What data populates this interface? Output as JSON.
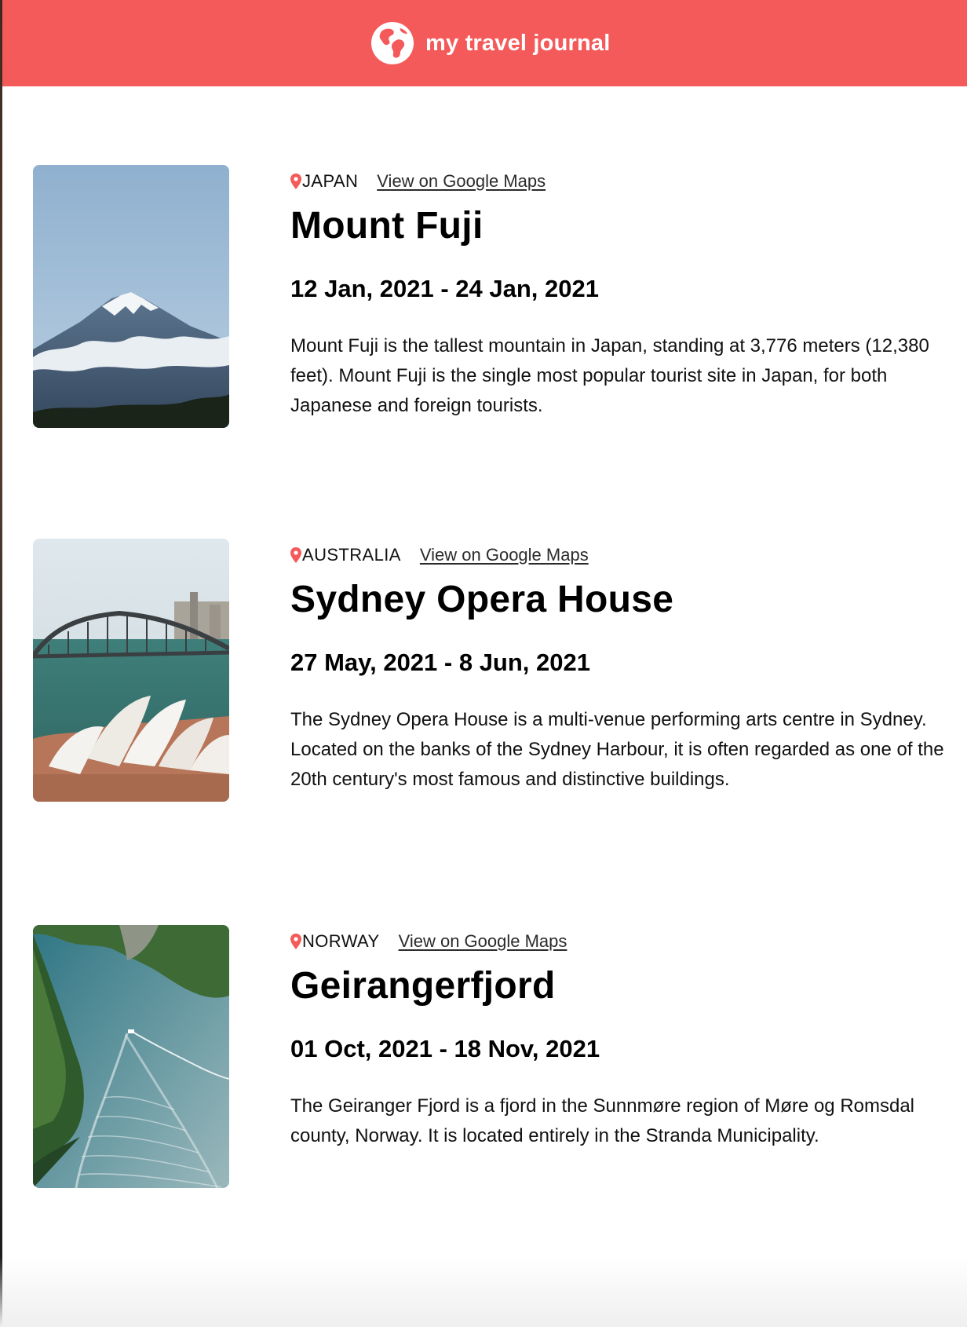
{
  "app": {
    "title": "my travel journal",
    "brand_color": "#F55A5A",
    "logo_icon": "globe-icon"
  },
  "entries": [
    {
      "country": "JAPAN",
      "maps_link_label": "View on Google Maps",
      "title": "Mount Fuji",
      "dates": "12 Jan, 2021 - 24 Jan, 2021",
      "description": "Mount Fuji is the tallest mountain in Japan, standing at 3,776 meters (12,380 feet). Mount Fuji is the single most popular tourist site in Japan, for both Japanese and foreign tourists.",
      "photo_subject": "snow-capped mountain above clouds"
    },
    {
      "country": "AUSTRALIA",
      "maps_link_label": "View on Google Maps",
      "title": "Sydney Opera House",
      "dates": "27 May, 2021 - 8 Jun, 2021",
      "description": "The Sydney Opera House is a multi-venue performing arts centre in Sydney. Located on the banks of the Sydney Harbour, it is often regarded as one of the 20th century's most famous and distinctive buildings.",
      "photo_subject": "opera house sails with harbour bridge"
    },
    {
      "country": "NORWAY",
      "maps_link_label": "View on Google Maps",
      "title": "Geirangerfjord",
      "dates": "01 Oct, 2021 - 18 Nov, 2021",
      "description": "The Geiranger Fjord is a fjord in the Sunnmøre region of Møre og Romsdal county, Norway. It is located entirely in the Stranda Municipality.",
      "photo_subject": "boat wake on a green fjord between cliffs"
    }
  ]
}
